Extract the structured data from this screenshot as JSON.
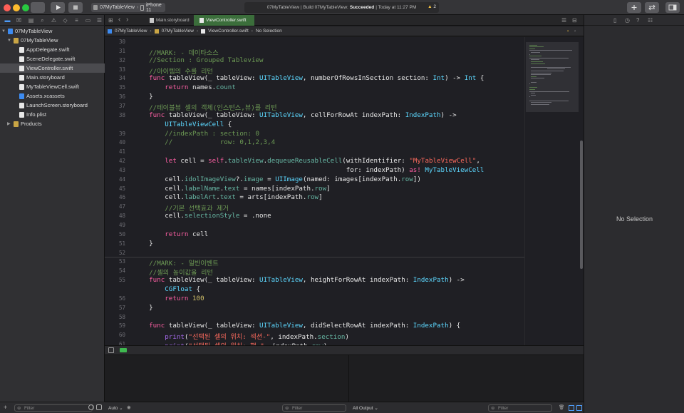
{
  "toolbar": {
    "scheme_target": "07MyTableView",
    "scheme_device": "iPhone 11",
    "activity_prefix": "07MyTableView | Build 07MyTableView:",
    "activity_status": "Succeeded",
    "activity_time": "| Today at 11:27 PM",
    "warning_count": "2"
  },
  "navigator": {
    "items": [
      {
        "label": "07MyTableView",
        "depth": 0,
        "type": "project",
        "expanded": true
      },
      {
        "label": "07MyTableView",
        "depth": 1,
        "type": "folder",
        "expanded": true
      },
      {
        "label": "AppDelegate.swift",
        "depth": 2,
        "type": "swift"
      },
      {
        "label": "SceneDelegate.swift",
        "depth": 2,
        "type": "swift"
      },
      {
        "label": "ViewController.swift",
        "depth": 2,
        "type": "swift",
        "selected": true
      },
      {
        "label": "Main.storyboard",
        "depth": 2,
        "type": "storyboard"
      },
      {
        "label": "MyTableViewCell.swift",
        "depth": 2,
        "type": "swift"
      },
      {
        "label": "Assets.xcassets",
        "depth": 2,
        "type": "assets"
      },
      {
        "label": "LaunchScreen.storyboard",
        "depth": 2,
        "type": "storyboard"
      },
      {
        "label": "Info.plist",
        "depth": 2,
        "type": "plist"
      },
      {
        "label": "Products",
        "depth": 1,
        "type": "folder",
        "expanded": false
      }
    ],
    "filter_placeholder": "Filter"
  },
  "tabs": [
    {
      "label": "Main.storyboard"
    },
    {
      "label": "ViewController.swift",
      "active": true
    }
  ],
  "jumpbar": [
    "07MyTableView",
    "07MyTableView",
    "ViewController.swift",
    "No Selection"
  ],
  "code": {
    "lines": [
      {
        "n": "30",
        "t": ""
      },
      {
        "n": "31",
        "t": "    //MARK: - 데이타소스"
      },
      {
        "n": "32",
        "t": "    //Section : Grouped Tableview"
      },
      {
        "n": "33",
        "t": "    //아이템의 수를 리턴"
      },
      {
        "n": "34",
        "t": "    func tableView(_ tableView: UITableView, numberOfRowsInSection section: Int) -> Int {"
      },
      {
        "n": "35",
        "t": "        return names.count"
      },
      {
        "n": "36",
        "t": "    }"
      },
      {
        "n": "37",
        "t": "    //테이블뷰 셀의 객체(인스턴스,뷰)를 리턴"
      },
      {
        "n": "38",
        "t": "    func tableView(_ tableView: UITableView, cellForRowAt indexPath: IndexPath) ->"
      },
      {
        "n": "",
        "t": "        UITableViewCell {"
      },
      {
        "n": "39",
        "t": "        //indexPath : section: 0"
      },
      {
        "n": "40",
        "t": "        //            row: 0,1,2,3,4"
      },
      {
        "n": "41",
        "t": ""
      },
      {
        "n": "42",
        "t": "        let cell = self.tableView.dequeueReusableCell(withIdentifier: \"MyTableViewCell\","
      },
      {
        "n": "43",
        "t": "                                                      for: indexPath) as! MyTableViewCell"
      },
      {
        "n": "44",
        "t": "        cell.idolImageView?.image = UIImage(named: images[indexPath.row])"
      },
      {
        "n": "45",
        "t": "        cell.labelName.text = names[indexPath.row]"
      },
      {
        "n": "46",
        "t": "        cell.labelArt.text = arts[indexPath.row]"
      },
      {
        "n": "47",
        "t": "        //기본 선택효과 제거"
      },
      {
        "n": "48",
        "t": "        cell.selectionStyle = .none"
      },
      {
        "n": "49",
        "t": ""
      },
      {
        "n": "50",
        "t": "        return cell"
      },
      {
        "n": "51",
        "t": "    }"
      },
      {
        "n": "52",
        "t": ""
      },
      {
        "n": "53",
        "t": "    //MARK: - 일반이벤트"
      },
      {
        "n": "54",
        "t": "    //셀의 높이값을 리턴"
      },
      {
        "n": "55",
        "t": "    func tableView(_ tableView: UITableView, heightForRowAt indexPath: IndexPath) ->"
      },
      {
        "n": "",
        "t": "        CGFloat {"
      },
      {
        "n": "56",
        "t": "        return 100"
      },
      {
        "n": "57",
        "t": "    }"
      },
      {
        "n": "58",
        "t": ""
      },
      {
        "n": "59",
        "t": "    func tableView(_ tableView: UITableView, didSelectRowAt indexPath: IndexPath) {"
      },
      {
        "n": "60",
        "t": "        print(\"선택된 셀의 위치: 섹션-\", indexPath.section)"
      },
      {
        "n": "61",
        "t": "        print(\"선택된 셀의 위치: 행-\", indexPath.row)"
      }
    ]
  },
  "debug": {
    "auto_label": "Auto",
    "filter_placeholder": "Filter",
    "output_label": "All Output",
    "output_filter_placeholder": "Filter"
  },
  "inspector": {
    "empty_label": "No Selection"
  }
}
